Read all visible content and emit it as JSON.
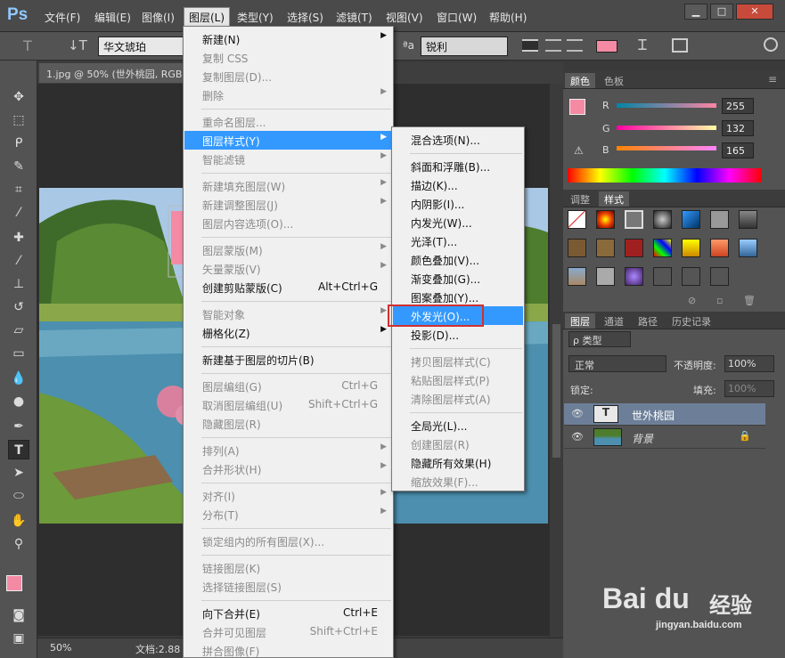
{
  "app": {
    "logo": "Ps"
  },
  "menubar": {
    "items": [
      "文件(F)",
      "编辑(E)",
      "图像(I)",
      "图层(L)",
      "类型(Y)",
      "选择(S)",
      "滤镜(T)",
      "视图(V)",
      "窗口(W)",
      "帮助(H)"
    ]
  },
  "window_controls": {
    "minimize": "▁",
    "maximize": "□",
    "close": "✕"
  },
  "options": {
    "font_family": "华文琥珀",
    "antialias_label": "ªa",
    "antialias": "锐利",
    "color": "#f48aa4"
  },
  "document": {
    "tab_title": "1.jpg @ 50% (世外桃园, RGB",
    "zoom": "50%",
    "doc_info": "文档:2.88"
  },
  "layer_menu": {
    "items": [
      {
        "label": "新建(N)",
        "sub": true,
        "dis": false
      },
      {
        "label": "复制 CSS",
        "dis": true
      },
      {
        "label": "复制图层(D)...",
        "dis": true
      },
      {
        "label": "删除",
        "sub": true,
        "dis": true
      },
      {
        "sep": true
      },
      {
        "label": "重命名图层...",
        "dis": true
      },
      {
        "label": "图层样式(Y)",
        "sub": true,
        "hl": true
      },
      {
        "label": "智能滤镜",
        "sub": true,
        "dis": true
      },
      {
        "sep": true
      },
      {
        "label": "新建填充图层(W)",
        "sub": true,
        "dis": true
      },
      {
        "label": "新建调整图层(J)",
        "sub": true,
        "dis": true
      },
      {
        "label": "图层内容选项(O)...",
        "dis": true
      },
      {
        "sep": true
      },
      {
        "label": "图层蒙版(M)",
        "sub": true,
        "dis": true
      },
      {
        "label": "矢量蒙版(V)",
        "sub": true,
        "dis": true
      },
      {
        "label": "创建剪贴蒙版(C)",
        "shortcut": "Alt+Ctrl+G"
      },
      {
        "sep": true
      },
      {
        "label": "智能对象",
        "sub": true,
        "dis": true
      },
      {
        "label": "栅格化(Z)",
        "sub": true
      },
      {
        "sep": true
      },
      {
        "label": "新建基于图层的切片(B)"
      },
      {
        "sep": true
      },
      {
        "label": "图层编组(G)",
        "shortcut": "Ctrl+G",
        "dis": true
      },
      {
        "label": "取消图层编组(U)",
        "shortcut": "Shift+Ctrl+G",
        "dis": true
      },
      {
        "label": "隐藏图层(R)",
        "dis": true
      },
      {
        "sep": true
      },
      {
        "label": "排列(A)",
        "sub": true,
        "dis": true
      },
      {
        "label": "合并形状(H)",
        "sub": true,
        "dis": true
      },
      {
        "sep": true
      },
      {
        "label": "对齐(I)",
        "sub": true,
        "dis": true
      },
      {
        "label": "分布(T)",
        "sub": true,
        "dis": true
      },
      {
        "sep": true
      },
      {
        "label": "锁定组内的所有图层(X)...",
        "dis": true
      },
      {
        "sep": true
      },
      {
        "label": "链接图层(K)",
        "dis": true
      },
      {
        "label": "选择链接图层(S)",
        "dis": true
      },
      {
        "sep": true
      },
      {
        "label": "向下合并(E)",
        "shortcut": "Ctrl+E"
      },
      {
        "label": "合并可见图层",
        "shortcut": "Shift+Ctrl+E",
        "dis": true
      },
      {
        "label": "拼合图像(F)",
        "dis": true
      }
    ]
  },
  "style_menu": {
    "items": [
      {
        "label": "混合选项(N)..."
      },
      {
        "sep": true
      },
      {
        "label": "斜面和浮雕(B)..."
      },
      {
        "label": "描边(K)..."
      },
      {
        "label": "内阴影(I)..."
      },
      {
        "label": "内发光(W)..."
      },
      {
        "label": "光泽(T)..."
      },
      {
        "label": "颜色叠加(V)..."
      },
      {
        "label": "渐变叠加(G)..."
      },
      {
        "label": "图案叠加(Y)..."
      },
      {
        "label": "外发光(O)...",
        "hl": true
      },
      {
        "label": "投影(D)..."
      },
      {
        "sep": true
      },
      {
        "label": "拷贝图层样式(C)",
        "dis": true
      },
      {
        "label": "粘贴图层样式(P)",
        "dis": true
      },
      {
        "label": "清除图层样式(A)",
        "dis": true
      },
      {
        "sep": true
      },
      {
        "label": "全局光(L)..."
      },
      {
        "label": "创建图层(R)",
        "dis": true
      },
      {
        "label": "隐藏所有效果(H)"
      },
      {
        "label": "缩放效果(F)...",
        "dis": true
      }
    ]
  },
  "color_panel": {
    "tabs": [
      "颜色",
      "色板"
    ],
    "channels": [
      {
        "name": "R",
        "value": "255"
      },
      {
        "name": "G",
        "value": "132"
      },
      {
        "name": "B",
        "value": "165"
      }
    ],
    "fg": "#f48aa4"
  },
  "styles_panel": {
    "tabs": [
      "调整",
      "样式"
    ]
  },
  "layers_panel": {
    "tabs": [
      "图层",
      "通道",
      "路径",
      "历史记录"
    ],
    "filter": "ρ 类型",
    "blend": "正常",
    "opacity_label": "不透明度:",
    "opacity": "100%",
    "lock_label": "锁定:",
    "fill_label": "填充:",
    "fill": "100%",
    "layers": [
      {
        "name": "世外桃园",
        "thumb": "T",
        "selected": true
      },
      {
        "name": "背景",
        "locked": true
      }
    ]
  },
  "watermark": {
    "logo": "Bai du",
    "text": "经验",
    "url": "jingyan.baidu.com"
  }
}
